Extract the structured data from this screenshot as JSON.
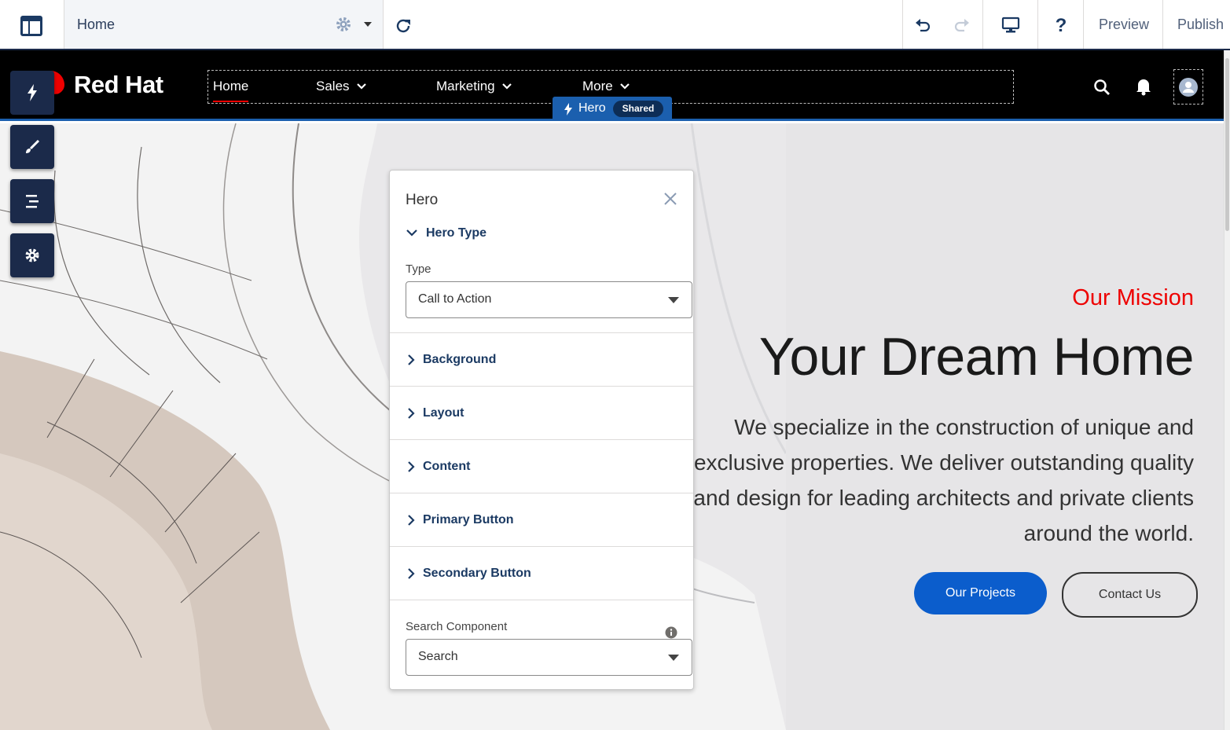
{
  "toolbar": {
    "page_title": "Home",
    "preview_label": "Preview",
    "publish_label": "Publish"
  },
  "site": {
    "logo_text": "Red Hat",
    "nav": {
      "home": "Home",
      "sales": "Sales",
      "marketing": "Marketing",
      "more": "More"
    },
    "component_tag": {
      "label": "Hero",
      "badge": "Shared"
    }
  },
  "hero": {
    "eyebrow": "Our Mission",
    "title": "Your Dream Home",
    "body": "We specialize in the construction of unique and exclusive properties. We deliver outstanding quality and design for leading architects and private clients around the world.",
    "primary_button": "Our Projects",
    "secondary_button": "Contact Us"
  },
  "panel": {
    "title": "Hero",
    "sections": {
      "hero_type": "Hero Type",
      "background": "Background",
      "layout": "Layout",
      "content": "Content",
      "primary_button": "Primary Button",
      "secondary_button": "Secondary Button"
    },
    "type_label": "Type",
    "type_value": "Call to Action",
    "search_label": "Search Component",
    "search_value": "Search"
  },
  "colors": {
    "builder_navy": "#1b2a4a",
    "accent_red": "#ee0000",
    "primary_blue": "#0b5dcc",
    "selection_blue": "#1b5fae"
  }
}
